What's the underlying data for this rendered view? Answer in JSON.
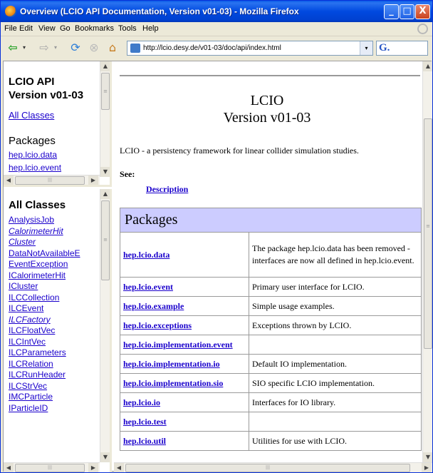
{
  "window": {
    "title": "Overview (LCIO API Documentation, Version v01-03) - Mozilla Firefox",
    "minimize": "_",
    "maximize": "□",
    "close": "X"
  },
  "menu": [
    "File",
    "Edit",
    "View",
    "Go",
    "Bookmarks",
    "Tools",
    "Help"
  ],
  "toolbar": {
    "back": "⇦",
    "forward": "⇨",
    "reload": "⟳",
    "stop": "⊗",
    "home": "⌂",
    "dropdown": "▾",
    "url": "http://lcio.desy.de/v01-03/doc/api/index.html",
    "search_engine": "G."
  },
  "top_frame": {
    "title_line1": "LCIO API",
    "title_line2": "Version v01-03",
    "all_classes_link": "All Classes",
    "packages_heading": "Packages",
    "packages": [
      "hep.lcio.data",
      "hep.lcio.event"
    ]
  },
  "classes_frame": {
    "heading": "All Classes",
    "classes": [
      {
        "name": "AnalysisJob",
        "italic": false
      },
      {
        "name": "CalorimeterHit",
        "italic": true
      },
      {
        "name": "Cluster",
        "italic": true
      },
      {
        "name": "DataNotAvailableE",
        "italic": false
      },
      {
        "name": "EventException",
        "italic": false
      },
      {
        "name": "ICalorimeterHit",
        "italic": false
      },
      {
        "name": "ICluster",
        "italic": false
      },
      {
        "name": "ILCCollection",
        "italic": false
      },
      {
        "name": "ILCEvent",
        "italic": false
      },
      {
        "name": "ILCFactory",
        "italic": true
      },
      {
        "name": "ILCFloatVec",
        "italic": false
      },
      {
        "name": "ILCIntVec",
        "italic": false
      },
      {
        "name": "ILCParameters",
        "italic": false
      },
      {
        "name": "ILCRelation",
        "italic": false
      },
      {
        "name": "ILCRunHeader",
        "italic": false
      },
      {
        "name": "ILCStrVec",
        "italic": false
      },
      {
        "name": "IMCParticle",
        "italic": false
      },
      {
        "name": "IParticleID",
        "italic": false
      }
    ]
  },
  "main": {
    "title_line1": "LCIO",
    "title_line2": "Version v01-03",
    "description": "LCIO - a persistency framework for linear collider simulation studies.",
    "see_label": "See:",
    "see_link": "Description",
    "packages_heading": "Packages",
    "packages": [
      {
        "name": "hep.lcio.data",
        "description": "The package hep.lcio.data has been removed - interfaces are now all defined in hep.lcio.event."
      },
      {
        "name": "hep.lcio.event",
        "description": "Primary user interface for LCIO."
      },
      {
        "name": "hep.lcio.example",
        "description": "Simple usage examples."
      },
      {
        "name": "hep.lcio.exceptions",
        "description": "Exceptions thrown by LCIO."
      },
      {
        "name": "hep.lcio.implementation.event",
        "description": ""
      },
      {
        "name": "hep.lcio.implementation.io",
        "description": "Default IO implementation."
      },
      {
        "name": "hep.lcio.implementation.sio",
        "description": "SIO specific LCIO implementation."
      },
      {
        "name": "hep.lcio.io",
        "description": "Interfaces for IO library."
      },
      {
        "name": "hep.lcio.test",
        "description": ""
      },
      {
        "name": "hep.lcio.util",
        "description": "Utilities for use with LCIO."
      }
    ]
  },
  "scroll": {
    "up": "▲",
    "down": "▼",
    "left": "◀",
    "right": "▶",
    "grip": "≡",
    "hgrip": "|||"
  }
}
